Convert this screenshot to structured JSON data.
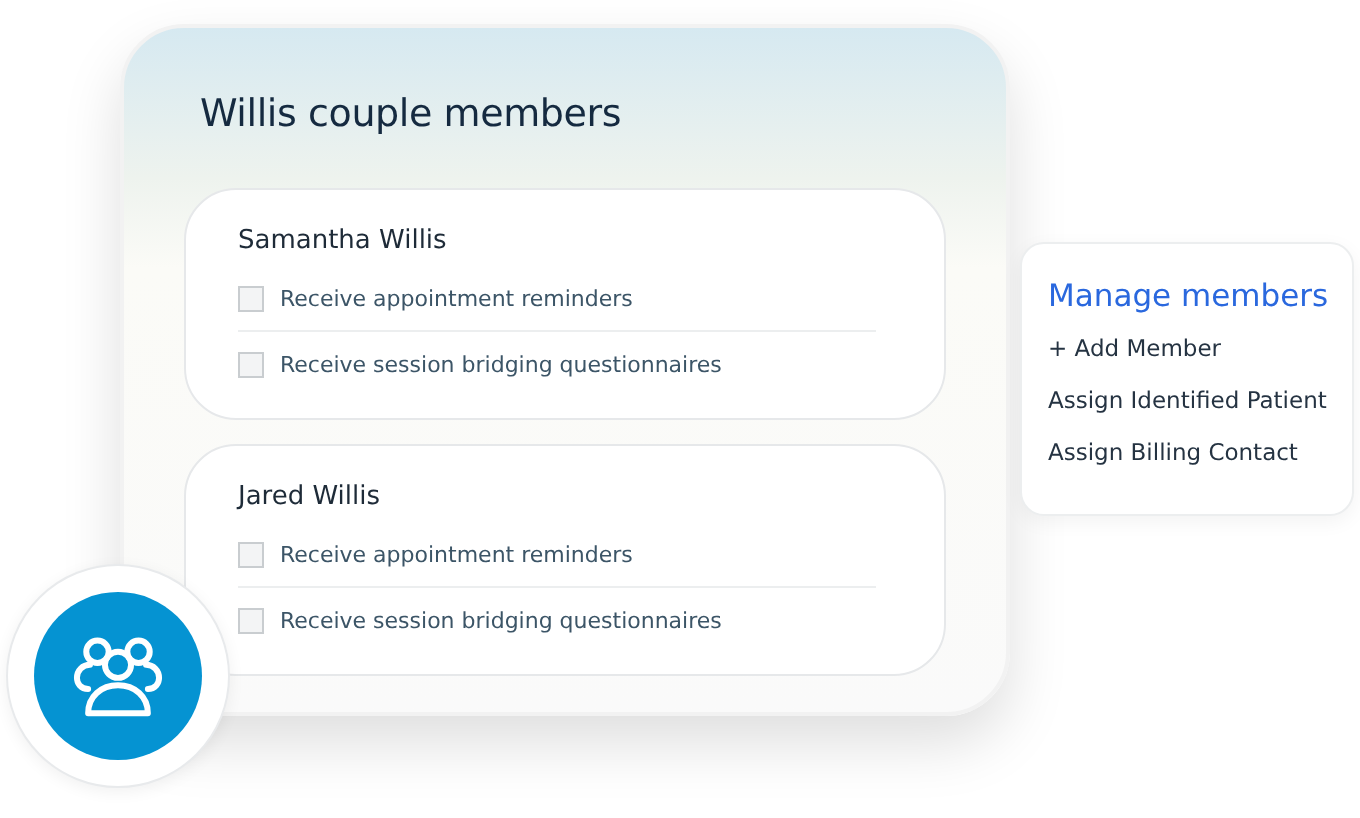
{
  "card": {
    "title": "Willis couple members",
    "members": [
      {
        "name": "Samantha Willis",
        "options": [
          {
            "label": "Receive appointment reminders",
            "checked": false
          },
          {
            "label": "Receive session bridging questionnaires",
            "checked": false
          }
        ]
      },
      {
        "name": "Jared Willis",
        "options": [
          {
            "label": "Receive appointment reminders",
            "checked": false
          },
          {
            "label": "Receive session bridging questionnaires",
            "checked": false
          }
        ]
      }
    ]
  },
  "manage_panel": {
    "title": "Manage members",
    "actions": [
      "+ Add Member",
      "Assign Identified Patient",
      "Assign Billing Contact"
    ]
  }
}
